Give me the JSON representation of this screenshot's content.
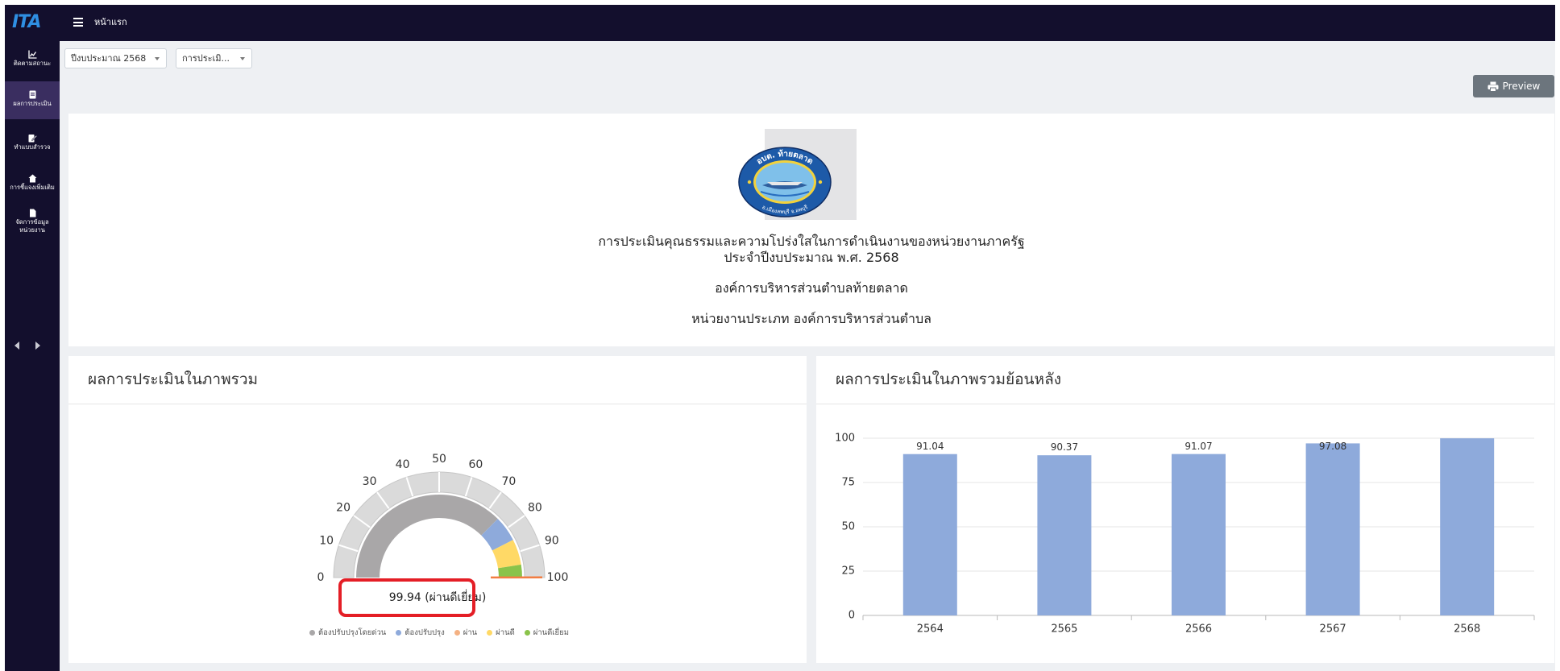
{
  "navbar": {
    "logo_text": "ITA",
    "page_title": "หน้าแรก",
    "menu_icon": "hamburger-icon"
  },
  "sidebar": {
    "items": [
      {
        "label": "ติดตามสถานะ",
        "icon": "chart-icon",
        "active": false
      },
      {
        "label": "ผลการประเมิน",
        "icon": "document-icon",
        "active": true
      },
      {
        "label": "ทำแบบสำรวจ",
        "icon": "edit-icon",
        "active": false
      },
      {
        "label": "การชี้แจงเพิ่มเติม",
        "icon": "home-icon",
        "active": false
      },
      {
        "label": "จัดการข้อมูล",
        "label_line2": "หน่วยงาน",
        "icon": "file-icon",
        "active": false
      }
    ],
    "prev_icon": "chevron-left-icon",
    "next_icon": "chevron-right-icon"
  },
  "filters": {
    "year": "ปีงบประมาณ 2568",
    "assessment": "การประเมิ..."
  },
  "toolbar": {
    "preview_label": "Preview",
    "preview_icon": "printer-icon"
  },
  "header": {
    "seal": {
      "top_text": "อบต. ท้ายตลาด",
      "bottom_text": "อ.เมืองลพบุรี จ.ลพบุรี"
    },
    "title": "การประเมินคุณธรรมและความโปร่งใสในการดำเนินงานของหน่วยงานภาครัฐ",
    "fiscal_year": "ประจำปีงบประมาณ พ.ศ. 2568",
    "organization": "องค์การบริหารส่วนตำบลท้ายตลาด",
    "org_type": "หน่วยงานประเภท องค์การบริหารส่วนตำบล"
  },
  "overall": {
    "title": "ผลการประเมินในภาพรวม",
    "result_text": "99.94 (ผ่านดีเยี่ยม)",
    "legend": [
      {
        "label": "ต้องปรับปรุงโดยด่วน",
        "color": "#a9a7a8"
      },
      {
        "label": "ต้องปรับปรุง",
        "color": "#8eaadb"
      },
      {
        "label": "ผ่าน",
        "color": "#f4b183"
      },
      {
        "label": "ผ่านดี",
        "color": "#ffd966"
      },
      {
        "label": "ผ่านดีเยี่ยม",
        "color": "#8ac34a"
      }
    ]
  },
  "history": {
    "title": "ผลการประเมินในภาพรวมย้อนหลัง"
  },
  "colors": {
    "navbar": "#130f2d",
    "sidebar_active": "#3a2e60",
    "preview_button": "#6c757d",
    "highlight_box": "#e41e26",
    "logo": "#2f8fe3"
  },
  "chart_data": [
    {
      "type": "gauge",
      "value": 99.94,
      "min": 0,
      "max": 100,
      "ticks": [
        0,
        10,
        20,
        30,
        40,
        50,
        60,
        70,
        80,
        90,
        100
      ],
      "bands": [
        {
          "from": 0,
          "to": 75,
          "color": "#a9a7a8"
        },
        {
          "from": 75,
          "to": 85,
          "color": "#8eaadb"
        },
        {
          "from": 85,
          "to": 95,
          "color": "#ffd966"
        },
        {
          "from": 95,
          "to": 100,
          "color": "#8ac34a"
        }
      ],
      "needle_color": "#f27d42",
      "legend_position": "bottom"
    },
    {
      "type": "bar",
      "categories": [
        "2564",
        "2565",
        "2566",
        "2567",
        "2568"
      ],
      "values": [
        91.04,
        90.37,
        91.07,
        97.08,
        99.94
      ],
      "data_labels": [
        "91.04",
        "90.37",
        "91.07",
        "97.08",
        ""
      ],
      "ylim": [
        0,
        100
      ],
      "yticks": [
        0,
        25,
        50,
        75,
        100
      ],
      "grid": true,
      "bar_color": "#8eaadb"
    }
  ]
}
